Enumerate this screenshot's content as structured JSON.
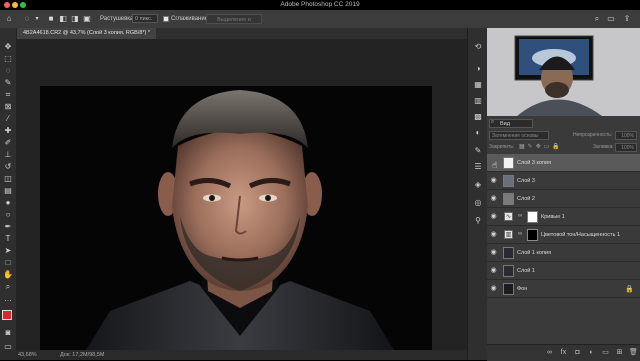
{
  "app": {
    "title": "Adobe Photoshop CC 2019"
  },
  "options_bar": {
    "feather_label": "Растушевка:",
    "feather_value": "0 пикс.",
    "antialias_label": "Сглаживание",
    "select_mask_label": "Выделение и маска..."
  },
  "document": {
    "tab_label": "4B2A4618.CR2 @ 43,7% (Слой 3 копия, RGB/8*) *"
  },
  "status_bar": {
    "zoom": "43,68%",
    "doc_size": "Док: 17,2M/98,5M"
  },
  "layers_panel": {
    "filter_kind": "Вид",
    "blend_mode": "Затемнение основы",
    "opacity_label": "Непрозрачность:",
    "opacity_value": "100%",
    "lock_label": "Закрепить:",
    "fill_label": "Заливка:",
    "fill_value": "100%",
    "layers": [
      {
        "name": "Слой 3 копия",
        "visible": false,
        "selected": true,
        "thumb_color": "#f2f2f2",
        "kind": "pixel-mask"
      },
      {
        "name": "Слой 3",
        "visible": true,
        "selected": false,
        "thumb_color": "#6a6f7a",
        "kind": "pixel"
      },
      {
        "name": "Слой 2",
        "visible": true,
        "selected": false,
        "thumb_color": "#7b7b7b",
        "kind": "pixel"
      },
      {
        "name": "Кривые 1",
        "visible": true,
        "selected": false,
        "thumb_color": "#e5e5e5",
        "kind": "adjustment"
      },
      {
        "name": "Цветовой тон/Насыщенность 1",
        "visible": true,
        "selected": false,
        "thumb_color": "#e5e5e5",
        "kind": "adjustment"
      },
      {
        "name": "Слой 1 копия",
        "visible": true,
        "selected": false,
        "thumb_color": "#2a2a30",
        "kind": "pixel"
      },
      {
        "name": "Слой 1",
        "visible": true,
        "selected": false,
        "thumb_color": "#2a2a30",
        "kind": "pixel"
      },
      {
        "name": "Фон",
        "visible": true,
        "selected": false,
        "thumb_color": "#1c1c20",
        "kind": "background"
      }
    ]
  },
  "colors": {
    "foreground": "#e0262b",
    "background": "#ffffff",
    "panel": "#3a3a3a",
    "selected_layer": "#5a5a5a"
  }
}
